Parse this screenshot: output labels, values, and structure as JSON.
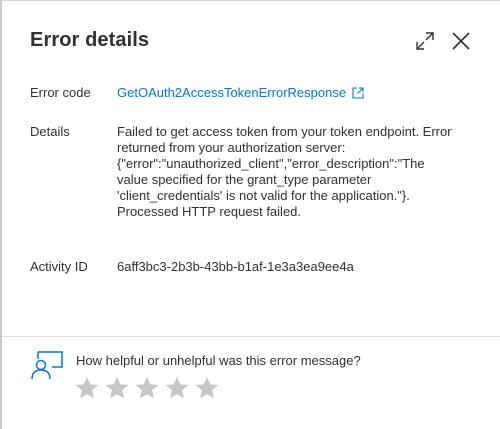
{
  "header": {
    "title": "Error details",
    "expand_icon": "expand-icon",
    "close_icon": "close-icon"
  },
  "fields": {
    "error_code_label": "Error code",
    "error_code_value": "GetOAuth2AccessTokenErrorResponse",
    "details_label": "Details",
    "details_lines": [
      "Failed to get access token from your token endpoint. Error",
      "returned from your authorization server:",
      "{\"error\":\"unauthorized_client\",\"error_description\":\"The",
      "value specified for the grant_type parameter",
      "'client_credentials' is not valid for the application.\"}.",
      "Processed HTTP request failed."
    ],
    "activity_id_label": "Activity ID",
    "activity_id_value": "6aff3bc3-2b3b-43bb-b1af-1e3a3ea9ee4a"
  },
  "feedback": {
    "question": "How helpful or unhelpful was this error message?",
    "rating": 0,
    "max_rating": 5
  },
  "colors": {
    "link": "#0078d4",
    "text": "#323130",
    "star_empty": "#c8c6c4",
    "icon": "#0078d4"
  }
}
